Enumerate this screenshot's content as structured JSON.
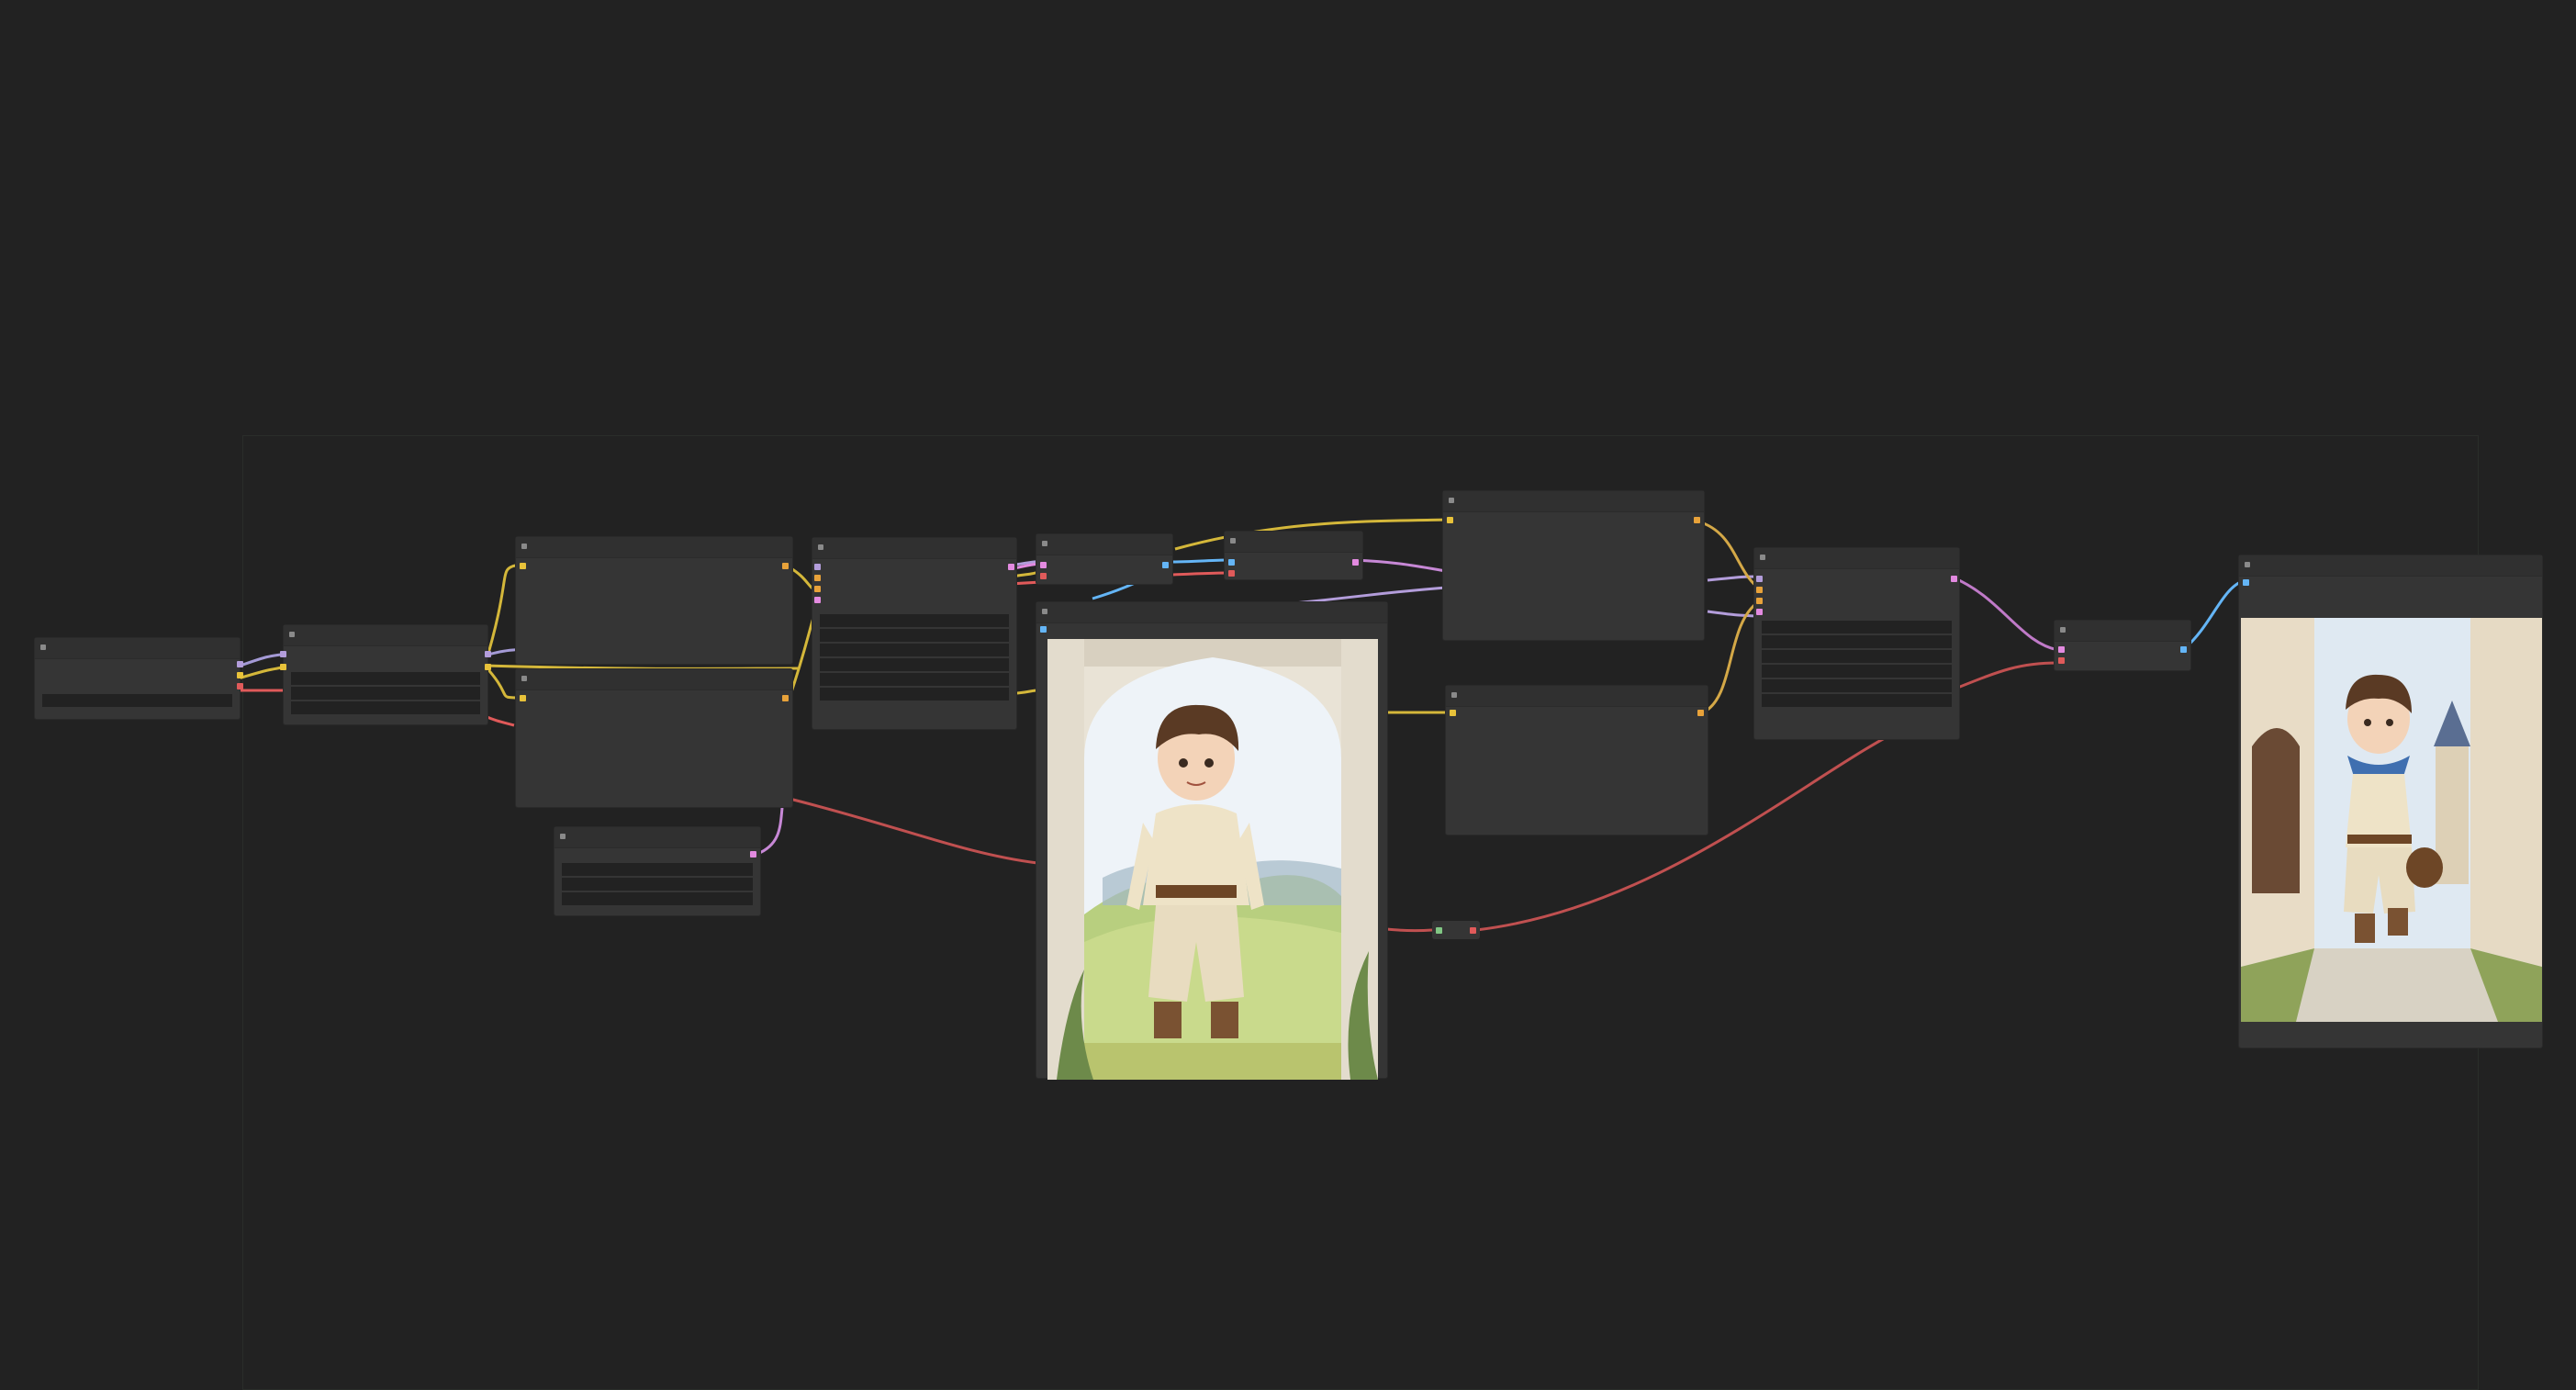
{
  "app": {
    "name": ""
  },
  "colors": {
    "background": "#222222",
    "node_body": "#353535",
    "node_title": "#303030",
    "widget": "#222222",
    "clip": "#b8a53a",
    "model": "#b39ddb",
    "vae": "#e05a5a",
    "conditioning": "#d4a847",
    "image": "#64b5f6",
    "latent": "#e38ae0",
    "mask": "#81c784"
  },
  "nodes": [
    {
      "id": "n1",
      "title": ""
    },
    {
      "id": "n2",
      "title": ""
    },
    {
      "id": "n3",
      "title": ""
    },
    {
      "id": "n4",
      "title": ""
    },
    {
      "id": "n5",
      "title": ""
    },
    {
      "id": "n6",
      "title": ""
    },
    {
      "id": "n7",
      "title": ""
    },
    {
      "id": "n8",
      "title": ""
    },
    {
      "id": "n9",
      "title": ""
    },
    {
      "id": "n10",
      "title": ""
    },
    {
      "id": "n11",
      "title": ""
    },
    {
      "id": "n12",
      "title": ""
    },
    {
      "id": "n13",
      "title": ""
    },
    {
      "id": "n14",
      "title": ""
    },
    {
      "id": "n15",
      "title": ""
    }
  ],
  "images": {
    "input_preview": "boy-in-archway-illustration",
    "output_preview": "boy-walking-village-street-illustration"
  }
}
